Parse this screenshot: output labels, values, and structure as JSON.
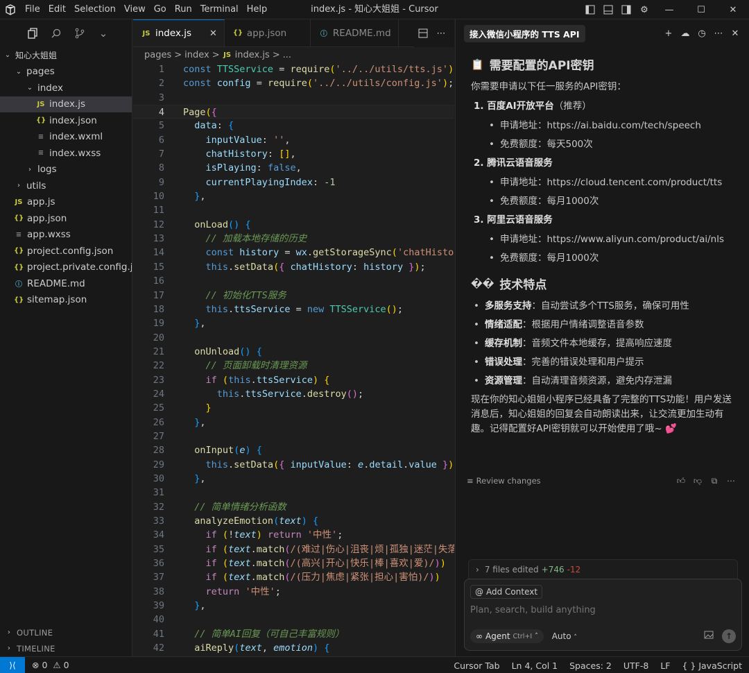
{
  "title_bar": {
    "menus": [
      "File",
      "Edit",
      "Selection",
      "View",
      "Go",
      "Run",
      "Terminal",
      "Help"
    ],
    "window_title": "index.js - 知心大姐姐 - Cursor"
  },
  "explorer": {
    "root": "知心大姐姐",
    "items": [
      {
        "label": "pages",
        "type": "folder",
        "depth": 1,
        "expanded": true
      },
      {
        "label": "index",
        "type": "folder",
        "depth": 2,
        "expanded": true
      },
      {
        "label": "index.js",
        "type": "js",
        "depth": 3,
        "selected": true
      },
      {
        "label": "index.json",
        "type": "json",
        "depth": 3
      },
      {
        "label": "index.wxml",
        "type": "wx",
        "depth": 3
      },
      {
        "label": "index.wxss",
        "type": "wx",
        "depth": 3
      },
      {
        "label": "logs",
        "type": "folder",
        "depth": 2,
        "expanded": false
      },
      {
        "label": "utils",
        "type": "folder",
        "depth": 1,
        "expanded": false
      },
      {
        "label": "app.js",
        "type": "js",
        "depth": 1
      },
      {
        "label": "app.json",
        "type": "json",
        "depth": 1
      },
      {
        "label": "app.wxss",
        "type": "wx",
        "depth": 1
      },
      {
        "label": "project.config.json",
        "type": "json",
        "depth": 1
      },
      {
        "label": "project.private.config.js...",
        "type": "json",
        "depth": 1
      },
      {
        "label": "README.md",
        "type": "md",
        "depth": 1
      },
      {
        "label": "sitemap.json",
        "type": "json",
        "depth": 1
      }
    ],
    "outline_label": "OUTLINE",
    "timeline_label": "TIMELINE"
  },
  "icons": {
    "js": "JS",
    "json": "{}",
    "md": "ⓘ",
    "wx": "≡"
  },
  "editor": {
    "tabs": [
      {
        "label": "index.js",
        "type": "js",
        "active": true
      },
      {
        "label": "app.json",
        "type": "json",
        "active": false
      },
      {
        "label": "README.md",
        "type": "md",
        "active": false
      }
    ],
    "breadcrumb": [
      "pages",
      ">",
      "index",
      ">",
      "index.js",
      ">",
      "..."
    ],
    "current_line": 4
  },
  "chat": {
    "tab_title": "接入微信小程序的 TTS API",
    "section1_title": "需要配置的API密钥",
    "section1_intro": "你需要申请以下任一服务的API密钥：",
    "services": [
      {
        "name": "1. 百度AI开放平台",
        "suffix": "（推荐）",
        "url_label": "申请地址：",
        "url": "https://ai.baidu.com/tech/speech",
        "quota_label": "免费额度：",
        "quota": "每天500次"
      },
      {
        "name": "2. 腾讯云语音服务",
        "suffix": "",
        "url_label": "申请地址：",
        "url": "https://cloud.tencent.com/product/tts",
        "quota_label": "免费额度：",
        "quota": "每月1000次"
      },
      {
        "name": "3. 阿里云语音服务",
        "suffix": "",
        "url_label": "申请地址：",
        "url": "https://www.aliyun.com/product/ai/nls",
        "quota_label": "免费额度：",
        "quota": "每月1000次"
      }
    ],
    "section2_title": "技术特点",
    "features": [
      {
        "name": "多服务支持",
        "desc": "：自动尝试多个TTS服务，确保可用性"
      },
      {
        "name": "情绪适配",
        "desc": "：根据用户情绪调整语音参数"
      },
      {
        "name": "缓存机制",
        "desc": "：音频文件本地缓存，提高响应速度"
      },
      {
        "name": "错误处理",
        "desc": "：完善的错误处理和用户提示"
      },
      {
        "name": "资源管理",
        "desc": "：自动清理音频资源，避免内存泄漏"
      }
    ],
    "closing": "现在你的知心姐姐小程序已经具备了完整的TTS功能！用户发送消息后，知心姐姐的回复会自动朗读出来，让交流更加生动有趣。记得配置好API密钥就可以开始使用了哦~ 💕",
    "review_label": "Review changes",
    "files_edited": "7 files edited",
    "additions": "+746",
    "deletions": "-12",
    "add_context": "Add Context",
    "input_placeholder": "Plan, search, build anything",
    "mode_label": "Agent",
    "mode_shortcut": "Ctrl+I",
    "model_label": "Auto"
  },
  "status_bar": {
    "errors": "0",
    "warnings": "0",
    "cursor_tab": "Cursor Tab",
    "position": "Ln 4, Col 1",
    "spaces": "Spaces: 2",
    "encoding": "UTF-8",
    "eol": "LF",
    "language": "{ } JavaScript"
  }
}
